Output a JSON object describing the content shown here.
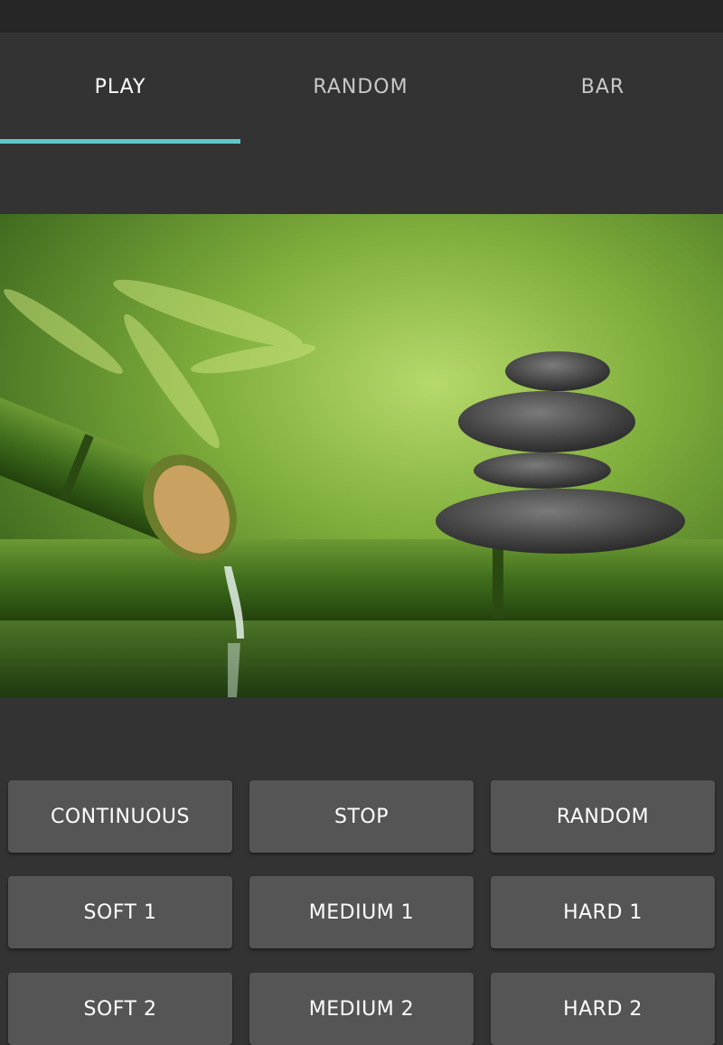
{
  "tabs": [
    {
      "label": "PLAY",
      "active": true
    },
    {
      "label": "RANDOM",
      "active": false
    },
    {
      "label": "BAR",
      "active": false
    }
  ],
  "accent_color": "#5fc8c6",
  "hero_image": "zen bamboo fountain with stacked stones",
  "buttons": [
    {
      "label": "CONTINUOUS"
    },
    {
      "label": "STOP"
    },
    {
      "label": "RANDOM"
    },
    {
      "label": "SOFT 1"
    },
    {
      "label": "MEDIUM 1"
    },
    {
      "label": "HARD 1"
    },
    {
      "label": "SOFT 2"
    },
    {
      "label": "MEDIUM 2"
    },
    {
      "label": "HARD 2"
    }
  ]
}
